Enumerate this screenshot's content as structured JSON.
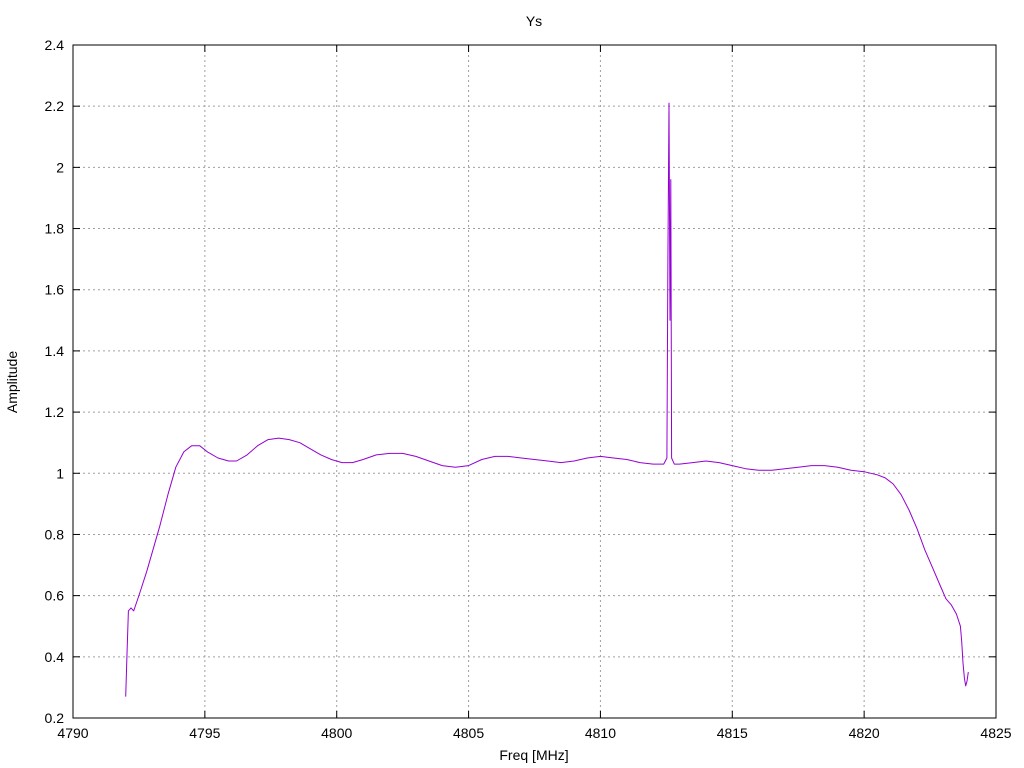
{
  "chart_data": {
    "type": "line",
    "title": "Ys",
    "xlabel": "Freq [MHz]",
    "ylabel": "Amplitude",
    "xlim": [
      4790,
      4825
    ],
    "ylim": [
      0.2,
      2.4
    ],
    "x_ticks": [
      4790,
      4795,
      4800,
      4805,
      4810,
      4815,
      4820,
      4825
    ],
    "y_ticks": [
      0.2,
      0.4,
      0.6,
      0.8,
      1,
      1.2,
      1.4,
      1.6,
      1.8,
      2,
      2.2,
      2.4
    ],
    "grid": true,
    "legend": "none",
    "series": [
      {
        "color": "#9400d3",
        "points": [
          [
            4792.0,
            0.27
          ],
          [
            4792.05,
            0.42
          ],
          [
            4792.1,
            0.55
          ],
          [
            4792.2,
            0.56
          ],
          [
            4792.3,
            0.55
          ],
          [
            4792.5,
            0.6
          ],
          [
            4792.8,
            0.68
          ],
          [
            4793.0,
            0.74
          ],
          [
            4793.3,
            0.83
          ],
          [
            4793.6,
            0.93
          ],
          [
            4793.9,
            1.02
          ],
          [
            4794.2,
            1.07
          ],
          [
            4794.5,
            1.09
          ],
          [
            4794.8,
            1.09
          ],
          [
            4795.1,
            1.07
          ],
          [
            4795.5,
            1.05
          ],
          [
            4795.9,
            1.04
          ],
          [
            4796.2,
            1.04
          ],
          [
            4796.6,
            1.06
          ],
          [
            4797.0,
            1.09
          ],
          [
            4797.4,
            1.11
          ],
          [
            4797.8,
            1.115
          ],
          [
            4798.2,
            1.11
          ],
          [
            4798.6,
            1.1
          ],
          [
            4799.0,
            1.08
          ],
          [
            4799.4,
            1.06
          ],
          [
            4799.8,
            1.045
          ],
          [
            4800.2,
            1.035
          ],
          [
            4800.6,
            1.035
          ],
          [
            4801.0,
            1.045
          ],
          [
            4801.5,
            1.06
          ],
          [
            4802.0,
            1.065
          ],
          [
            4802.5,
            1.065
          ],
          [
            4803.0,
            1.055
          ],
          [
            4803.5,
            1.04
          ],
          [
            4804.0,
            1.025
          ],
          [
            4804.5,
            1.02
          ],
          [
            4805.0,
            1.025
          ],
          [
            4805.5,
            1.045
          ],
          [
            4806.0,
            1.055
          ],
          [
            4806.5,
            1.055
          ],
          [
            4807.0,
            1.05
          ],
          [
            4807.5,
            1.045
          ],
          [
            4808.0,
            1.04
          ],
          [
            4808.5,
            1.035
          ],
          [
            4809.0,
            1.04
          ],
          [
            4809.5,
            1.05
          ],
          [
            4810.0,
            1.055
          ],
          [
            4810.5,
            1.05
          ],
          [
            4811.0,
            1.045
          ],
          [
            4811.5,
            1.035
          ],
          [
            4812.0,
            1.03
          ],
          [
            4812.4,
            1.03
          ],
          [
            4812.52,
            1.05
          ],
          [
            4812.56,
            1.7
          ],
          [
            4812.6,
            2.21
          ],
          [
            4812.64,
            1.5
          ],
          [
            4812.67,
            1.96
          ],
          [
            4812.7,
            1.05
          ],
          [
            4812.8,
            1.03
          ],
          [
            4813.0,
            1.03
          ],
          [
            4813.5,
            1.035
          ],
          [
            4814.0,
            1.04
          ],
          [
            4814.5,
            1.035
          ],
          [
            4815.0,
            1.025
          ],
          [
            4815.5,
            1.015
          ],
          [
            4816.0,
            1.01
          ],
          [
            4816.5,
            1.01
          ],
          [
            4817.0,
            1.015
          ],
          [
            4817.5,
            1.02
          ],
          [
            4818.0,
            1.025
          ],
          [
            4818.5,
            1.025
          ],
          [
            4819.0,
            1.02
          ],
          [
            4819.5,
            1.01
          ],
          [
            4820.0,
            1.005
          ],
          [
            4820.5,
            0.995
          ],
          [
            4820.8,
            0.985
          ],
          [
            4821.1,
            0.965
          ],
          [
            4821.4,
            0.93
          ],
          [
            4821.7,
            0.88
          ],
          [
            4822.0,
            0.82
          ],
          [
            4822.3,
            0.75
          ],
          [
            4822.6,
            0.69
          ],
          [
            4822.9,
            0.63
          ],
          [
            4823.1,
            0.59
          ],
          [
            4823.3,
            0.57
          ],
          [
            4823.5,
            0.54
          ],
          [
            4823.65,
            0.5
          ],
          [
            4823.7,
            0.45
          ],
          [
            4823.75,
            0.38
          ],
          [
            4823.8,
            0.33
          ],
          [
            4823.85,
            0.305
          ],
          [
            4823.9,
            0.32
          ],
          [
            4823.95,
            0.35
          ]
        ]
      }
    ]
  }
}
